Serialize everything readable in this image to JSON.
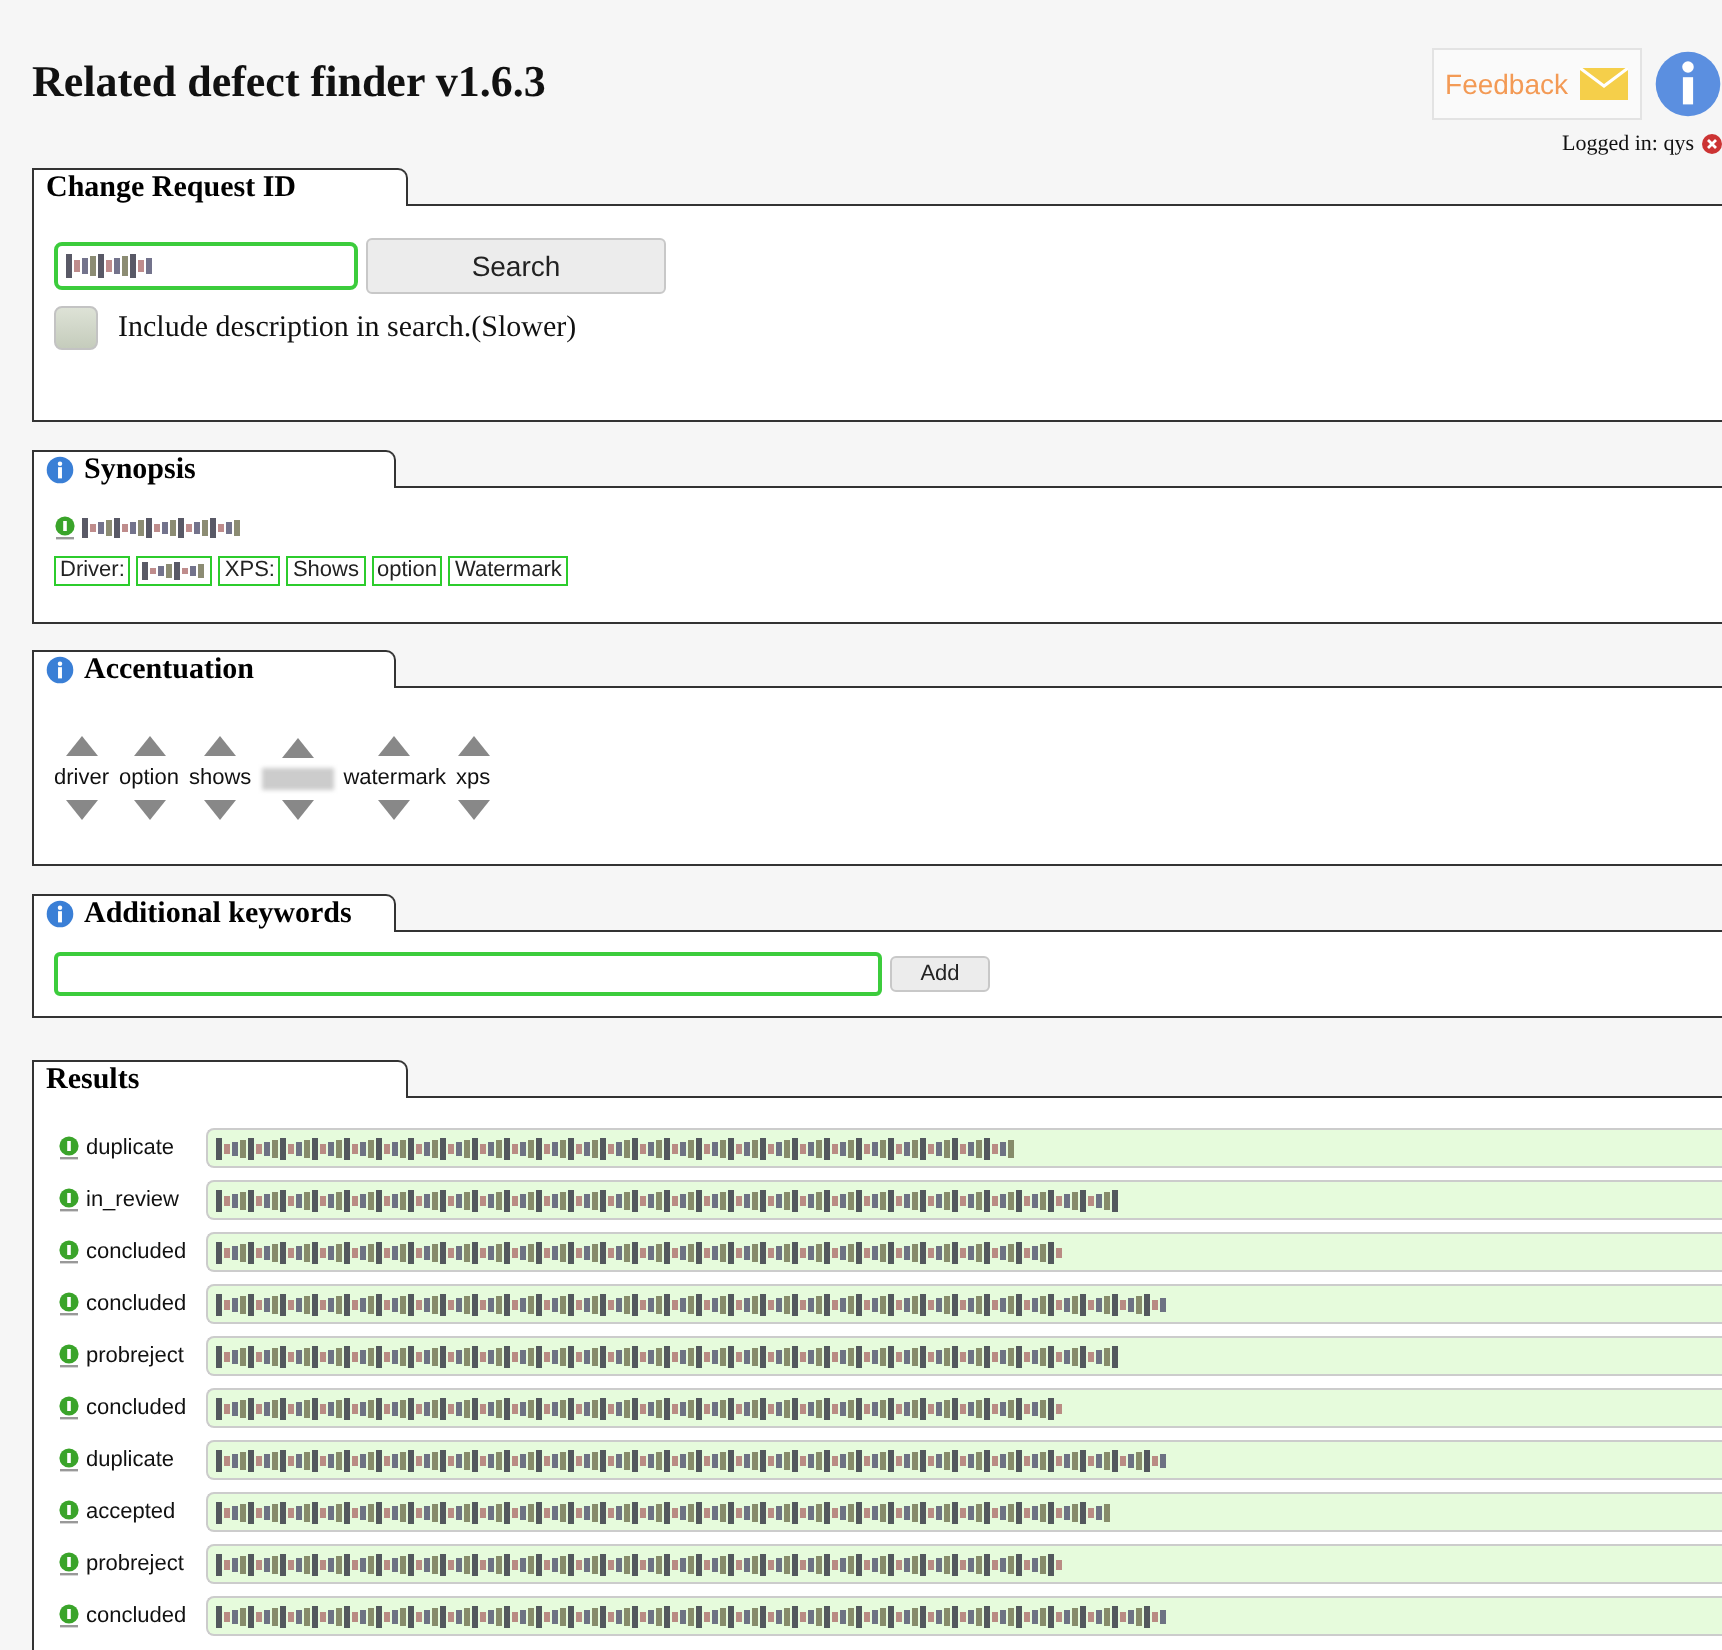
{
  "title": "Related defect finder v1.6.3",
  "header": {
    "feedback": "Feedback",
    "login": "Logged in: qys"
  },
  "change_request": {
    "heading": "Change Request ID",
    "id_field": {
      "obscured": true
    },
    "search_button": "Search",
    "include_description": {
      "label": "Include description in search.(Slower)",
      "checked": false
    }
  },
  "synopsis": {
    "heading": "Synopsis",
    "id": {
      "obscured": true
    },
    "tags": [
      {
        "label": "Driver:",
        "kind": "word"
      },
      {
        "kind": "obscured"
      },
      {
        "label": "XPS:",
        "kind": "word"
      },
      {
        "label": "Shows",
        "kind": "word"
      },
      {
        "label": "option",
        "kind": "word"
      },
      {
        "label": "Watermark",
        "kind": "word"
      }
    ]
  },
  "accentuation": {
    "heading": "Accentuation",
    "keywords": [
      {
        "label": "driver",
        "kind": "word"
      },
      {
        "label": "option",
        "kind": "word"
      },
      {
        "label": "shows",
        "kind": "word"
      },
      {
        "kind": "obscured"
      },
      {
        "label": "watermark",
        "kind": "word"
      },
      {
        "label": "xps",
        "kind": "word"
      }
    ]
  },
  "additional_keywords": {
    "heading": "Additional keywords",
    "add_button": "Add"
  },
  "results": {
    "heading": "Results",
    "rows": [
      {
        "status": "duplicate"
      },
      {
        "status": "in_review"
      },
      {
        "status": "concluded"
      },
      {
        "status": "concluded"
      },
      {
        "status": "probreject"
      },
      {
        "status": "concluded"
      },
      {
        "status": "duplicate"
      },
      {
        "status": "accepted"
      },
      {
        "status": "probreject"
      },
      {
        "status": "concluded"
      }
    ]
  }
}
